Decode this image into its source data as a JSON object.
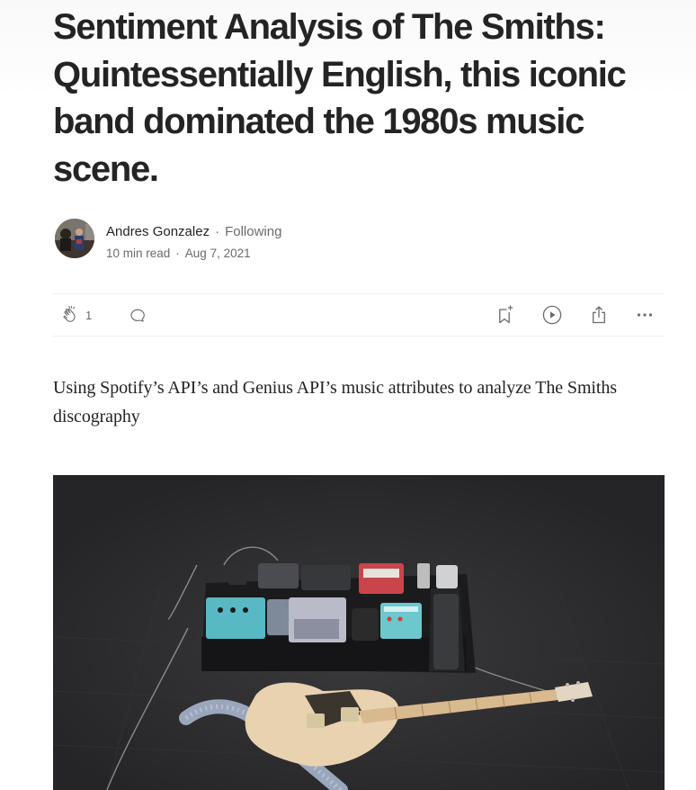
{
  "article": {
    "title": "Sentiment Analysis of The Smiths: Quintessentially English, this iconic band dominated the 1980s music scene.",
    "subtitle": "Using Spotify’s API’s and Genius API’s music attributes to analyze The Smiths discography"
  },
  "author": {
    "name": "Andres Gonzalez",
    "separator": "·",
    "follow_label": "Following",
    "read_time": "10 min read",
    "date": "Aug 7, 2021"
  },
  "actions": {
    "clap_count": "1",
    "icons": [
      "clap-icon",
      "comment-icon",
      "bookmark-icon",
      "listen-icon",
      "share-icon",
      "more-icon"
    ]
  },
  "colors": {
    "text": "#242424",
    "muted": "#6b6b6b",
    "divider": "#f0f0f0",
    "hero_bg": "#2b2a2c"
  }
}
